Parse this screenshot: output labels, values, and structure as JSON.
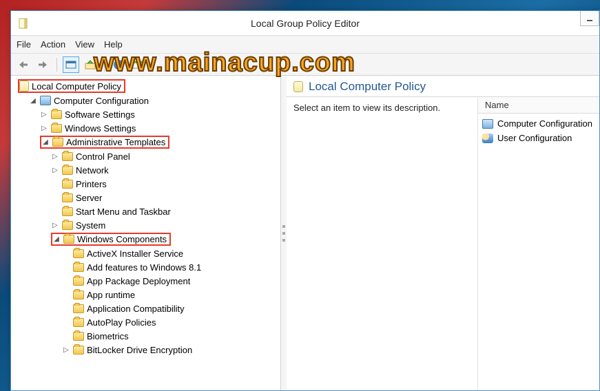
{
  "window": {
    "title": "Local Group Policy Editor"
  },
  "menu": {
    "file": "File",
    "action": "Action",
    "view": "View",
    "help": "Help"
  },
  "watermark": "www.mainacup.com",
  "tree": {
    "root": "Local Computer Policy",
    "comp_config": "Computer Configuration",
    "software_settings": "Software Settings",
    "windows_settings": "Windows Settings",
    "admin_templates": "Administrative Templates",
    "control_panel": "Control Panel",
    "network": "Network",
    "printers": "Printers",
    "server": "Server",
    "start_menu": "Start Menu and Taskbar",
    "system": "System",
    "win_components": "Windows Components",
    "wc": {
      "activex": "ActiveX Installer Service",
      "addfeat": "Add features to Windows 8.1",
      "apppkg": "App Package Deployment",
      "apprt": "App runtime",
      "appcomp": "Application Compatibility",
      "autoplay": "AutoPlay Policies",
      "biometrics": "Biometrics",
      "bitlocker": "BitLocker Drive Encryption"
    }
  },
  "right": {
    "title": "Local Computer Policy",
    "description": "Select an item to view its description.",
    "col_name": "Name",
    "items": {
      "comp": "Computer Configuration",
      "user": "User Configuration"
    }
  }
}
